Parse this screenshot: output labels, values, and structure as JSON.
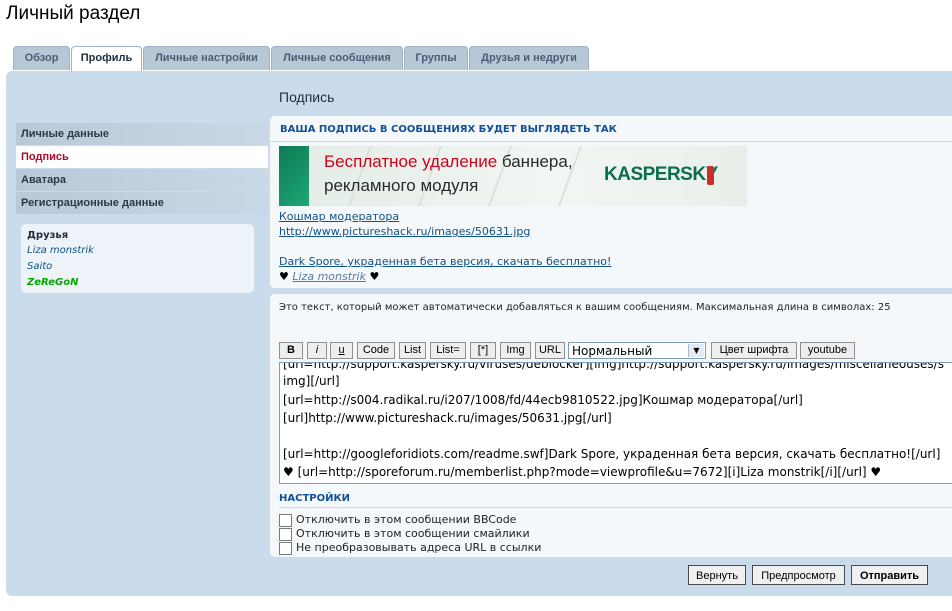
{
  "page": {
    "title": "Личный раздел"
  },
  "tabs": [
    {
      "label": "Обзор",
      "active": false
    },
    {
      "label": "Профиль",
      "active": true
    },
    {
      "label": "Личные настройки",
      "active": false
    },
    {
      "label": "Личные сообщения",
      "active": false
    },
    {
      "label": "Группы",
      "active": false
    },
    {
      "label": "Друзья и недруги",
      "active": false
    }
  ],
  "section": {
    "title": "Подпись"
  },
  "sidebar": {
    "items": [
      {
        "label": "Личные данные",
        "active": false
      },
      {
        "label": "Подпись",
        "active": true
      },
      {
        "label": "Аватара",
        "active": false
      },
      {
        "label": "Регистрационные данные",
        "active": false
      }
    ]
  },
  "friends": {
    "title": "Друзья",
    "list": [
      "Liza monstrik",
      "Saito",
      "ZeReGoN"
    ]
  },
  "preview": {
    "heading": "Ваша подпись в сообщениях будет выглядеть так",
    "banner": {
      "line1_red": "Бесплатное удаление",
      "line1_rest": " баннера,",
      "line2": "рекламного модуля",
      "brand": "KASPERSKY"
    },
    "link1": "Кошмар модератора",
    "link2": "http://www.pictureshack.ru/images/50631.jpg",
    "link3": "Dark Spore, украденная бета версия, скачать бесплатно!",
    "heart_left": "♥",
    "signature_name": "Liza monstrik",
    "heart_right": "♥"
  },
  "editor": {
    "description": "Это текст, который может автоматически добавляться к вашим сообщениям. Максимальная длина в символах: 25",
    "toolbar": {
      "bold": "B",
      "italic": "i",
      "underline": "u",
      "code": "Code",
      "list": "List",
      "list_eq": "List=",
      "star": "[*]",
      "img": "Img",
      "url": "URL",
      "font_size": "Нормальный",
      "font_color": "Цвет шрифта",
      "youtube": "youtube"
    },
    "lines": [
      "[url=http://support.kaspersky.ru/viruses/deblocker][img]http://support.kaspersky.ru/images/miscellaneouses/s",
      "img][/url]",
      "[url=http://s004.radikal.ru/i207/1008/fd/44ecb9810522.jpg]Кошмар модератора[/url]",
      "[url]http://www.pictureshack.ru/images/50631.jpg[/url]",
      "",
      "[url=http://googleforidiots.com/readme.swf]Dark Spore, украденная бета версия, скачать бесплатно![/url]",
      "♥ [url=http://sporeforum.ru/memberlist.php?mode=viewprofile&u=7672][i]Liza monstrik[/i][/url] ♥"
    ]
  },
  "settings": {
    "heading": "Настройки",
    "options": [
      "Отключить в этом сообщении BBCode",
      "Отключить в этом сообщении смайлики",
      "Не преобразовывать адреса URL в ссылки"
    ]
  },
  "actions": {
    "reset": "Вернуть",
    "preview": "Предпросмотр",
    "submit": "Отправить"
  }
}
